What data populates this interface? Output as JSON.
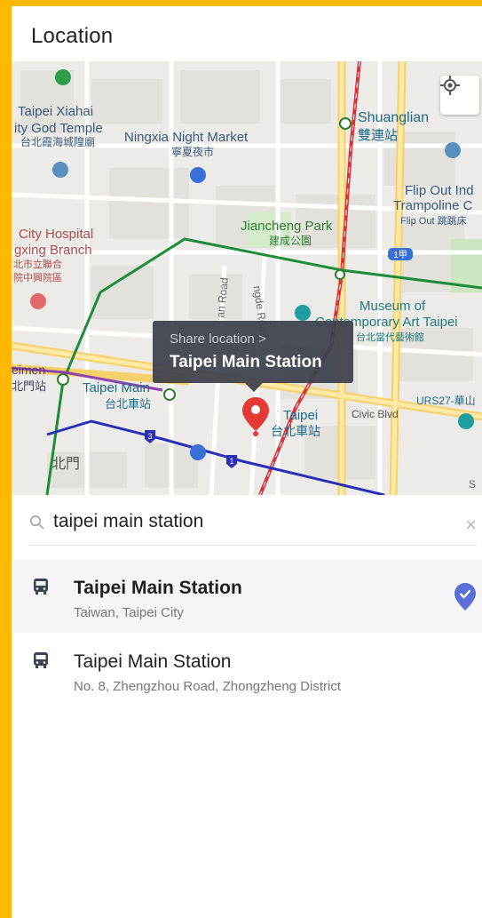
{
  "header": {
    "title": "Location"
  },
  "map": {
    "labels": {
      "xiahai_en": "Taipei Xiahai",
      "xiahai_en2": "ity God Temple",
      "xiahai_zh": "台北霞海城隍廟",
      "ningxia_en": "Ningxia Night Market",
      "ningxia_zh": "寧夏夜市",
      "shuanglian_en": "Shuanglian",
      "shuanglian_zh": "雙連站",
      "flipout_en1": "Flip Out Ind",
      "flipout_en2": "Trampoline C",
      "flipout_zh": "Flip Out 跳跳床",
      "jiancheng_en": "Jiancheng Park",
      "jiancheng_zh": "建成公園",
      "hospital_en1": "City Hospital",
      "hospital_en2": "gxing Branch",
      "hospital_zh1": "北市立聯合",
      "hospital_zh2": "院中興院區",
      "museum_en1": "Museum of",
      "museum_en2": "Contemporary Art Taipei",
      "museum_zh": "台北當代藝術館",
      "ximen_en": "eimen",
      "ximen_zh": "北門站",
      "tms_en": "Taipei Main",
      "tms_zh": "台北車站",
      "taipei_en": "Taipei",
      "taipei_zh": "台北車站",
      "civic": "Civic Blvd",
      "urs27": "URS27-華山",
      "beimen": "北門",
      "road1": "an Road",
      "road2": "ngde Road",
      "road3": "S",
      "road_shield": "1甲",
      "shield3": "3",
      "shield1": "1"
    },
    "bubble": {
      "subtitle": "Share location >",
      "title": "Taipei Main Station"
    }
  },
  "search": {
    "query": "taipei main station",
    "clear_label": "×"
  },
  "results": [
    {
      "name": "Taipei Main Station",
      "address": "Taiwan, Taipei City",
      "selected": true,
      "icon": "bus-icon"
    },
    {
      "name": "Taipei Main Station",
      "address": "No. 8, Zhengzhou Road, Zhongzheng District",
      "selected": false,
      "icon": "bus-icon"
    }
  ],
  "colors": {
    "frame": "#FFB800",
    "selection_check": "#5B6FD6",
    "pin": "#E53935",
    "metro_green": "#1E8C3A",
    "metro_blue": "#2A2FB8",
    "metro_red": "#D8323A"
  }
}
